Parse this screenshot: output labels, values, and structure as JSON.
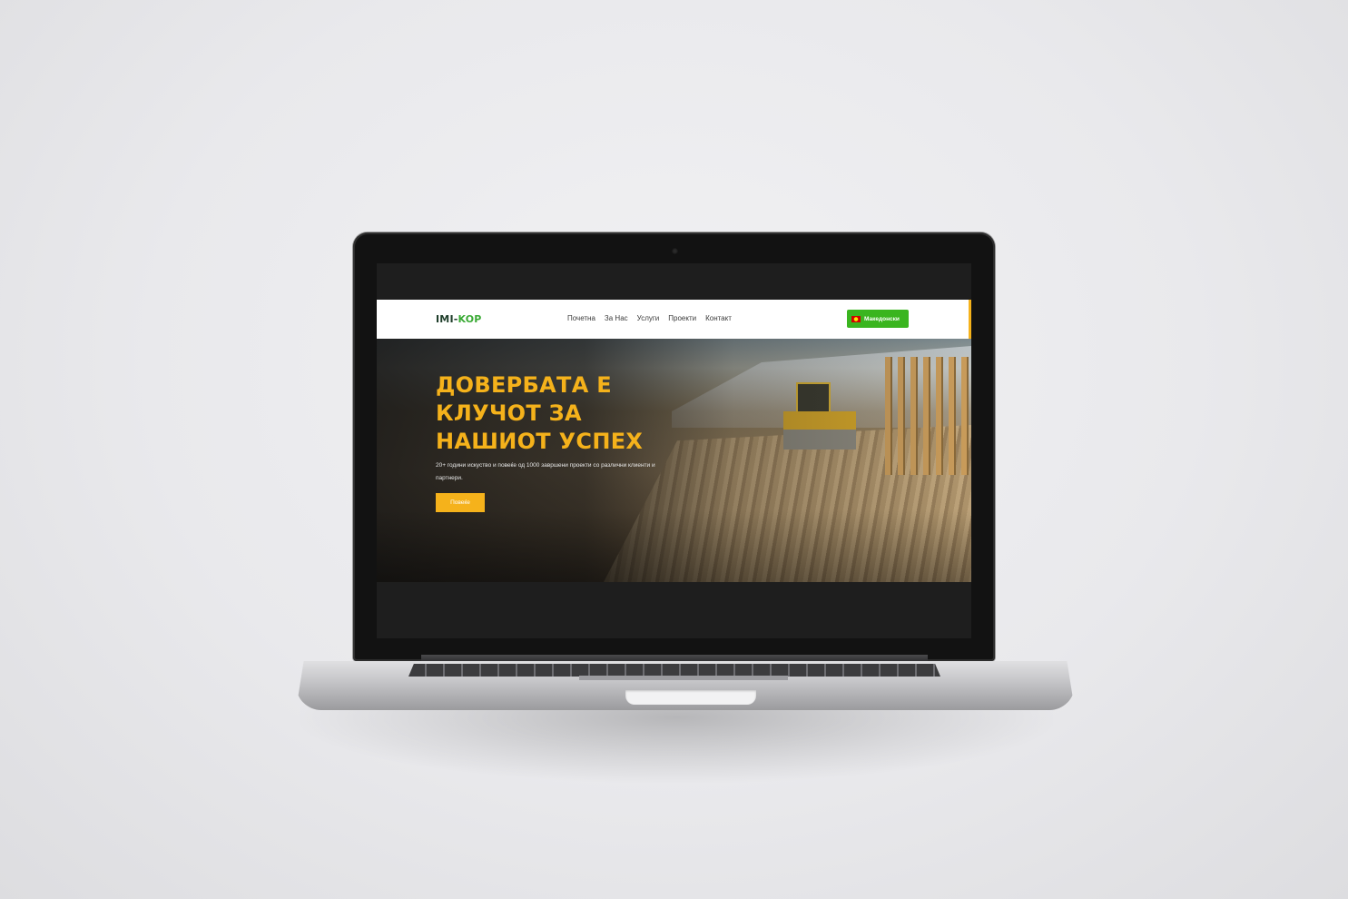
{
  "site": {
    "logo_part1": "IMI-",
    "logo_part2": "KOP",
    "nav": {
      "items": [
        {
          "label": "Почетна"
        },
        {
          "label": "За Нас"
        },
        {
          "label": "Услуги"
        },
        {
          "label": "Проекти"
        },
        {
          "label": "Контакт"
        }
      ],
      "language_label": "Македонски"
    },
    "hero": {
      "title": "ДОВЕРБАТА Е КЛУЧОТ ЗА НАШИОТ УСПЕХ",
      "subtitle": "20+ години искуство и повеќе од 1000 завршени проекти со различни клиенти и партнери.",
      "cta_label": "Повеќе"
    },
    "slider": {
      "prev_symbol": "‹",
      "next_symbol": "›"
    }
  },
  "colors": {
    "accent_yellow": "#f5b21b",
    "brand_green": "#3aaa35",
    "brand_dark": "#1e3d2a",
    "language_button": "#3ab51f"
  },
  "icons": [
    "macedonian-flag-icon",
    "chevron-left-icon",
    "chevron-right-icon",
    "camera-icon"
  ]
}
